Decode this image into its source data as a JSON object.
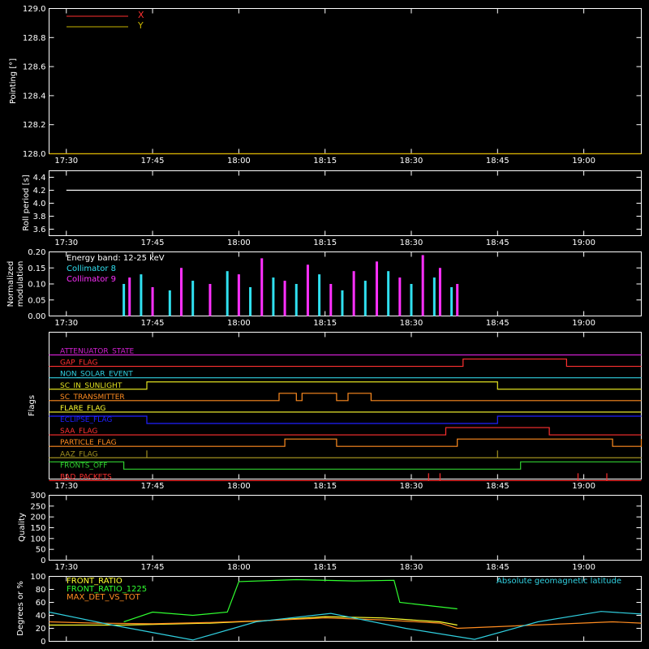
{
  "time_ticks": [
    "17:30",
    "17:45",
    "18:00",
    "18:15",
    "18:30",
    "18:45",
    "19:00"
  ],
  "time_range": [
    "17:27",
    "19:10"
  ],
  "colors": {
    "background": "#000000",
    "axes": "#ffffff",
    "x": "#ff3030",
    "y": "#c8b400",
    "collimator8": "#30e0f0",
    "collimator9": "#ff30ff",
    "front_ratio": "#ffff30",
    "front_ratio_1225": "#30ff30",
    "max_det": "#ff8c20",
    "geomag": "#30d0e0"
  },
  "chart_data": [
    {
      "type": "line",
      "ylabel": "Pointing [°]",
      "ylim": [
        128.0,
        129.0
      ],
      "yticks": [
        "128.0",
        "128.2",
        "128.4",
        "128.6",
        "128.8",
        "129.0"
      ],
      "legend": [
        "X",
        "Y"
      ],
      "series": [
        {
          "name": "X",
          "x": [
            "17:27",
            "19:10"
          ],
          "values": [
            128.0,
            128.0
          ]
        },
        {
          "name": "Y",
          "x": [
            "17:27",
            "19:10"
          ],
          "values": [
            128.0,
            128.0
          ]
        }
      ]
    },
    {
      "type": "line",
      "ylabel": "Roll period [s]",
      "ylim": [
        3.5,
        4.5
      ],
      "yticks": [
        "3.6",
        "3.8",
        "4.0",
        "4.2",
        "4.4"
      ],
      "series": [
        {
          "x": [
            "17:30",
            "17:45",
            "18:00",
            "18:15",
            "18:30",
            "18:45",
            "19:00",
            "19:10"
          ],
          "values": [
            4.2,
            4.2,
            4.2,
            4.2,
            4.2,
            4.2,
            4.2,
            4.2
          ]
        }
      ]
    },
    {
      "type": "bar",
      "ylabel": [
        "Normalized",
        "modulation"
      ],
      "ylim": [
        0,
        0.2
      ],
      "yticks": [
        "0.00",
        "0.05",
        "0.10",
        "0.15",
        "0.20"
      ],
      "annotation": "Energy band: 12-25 keV",
      "series": [
        {
          "name": "Collimator 8",
          "x": [
            "17:40",
            "17:43",
            "17:48",
            "17:52",
            "17:58",
            "18:02",
            "18:06",
            "18:10",
            "18:14",
            "18:18",
            "18:22",
            "18:26",
            "18:30",
            "18:34",
            "18:37"
          ],
          "values": [
            0.1,
            0.13,
            0.08,
            0.11,
            0.14,
            0.09,
            0.12,
            0.1,
            0.13,
            0.08,
            0.11,
            0.14,
            0.1,
            0.12,
            0.09
          ]
        },
        {
          "name": "Collimator 9",
          "x": [
            "17:41",
            "17:45",
            "17:50",
            "17:55",
            "18:00",
            "18:04",
            "18:08",
            "18:12",
            "18:16",
            "18:20",
            "18:24",
            "18:28",
            "18:32",
            "18:35",
            "18:38"
          ],
          "values": [
            0.12,
            0.09,
            0.15,
            0.1,
            0.13,
            0.18,
            0.11,
            0.16,
            0.1,
            0.14,
            0.17,
            0.12,
            0.19,
            0.15,
            0.1
          ]
        }
      ]
    },
    {
      "type": "line",
      "ylabel": "Flags",
      "flags": [
        {
          "name": "ATTENUATOR_STATE",
          "color": "#d020d0",
          "transitions": [
            [
              "17:27",
              0
            ]
          ]
        },
        {
          "name": "GAP_FLAG",
          "color": "#ff3030",
          "transitions": [
            [
              "17:27",
              0
            ],
            [
              "18:39",
              1
            ],
            [
              "18:57",
              0
            ]
          ]
        },
        {
          "name": "NON_SOLAR_EVENT",
          "color": "#30d0e0",
          "transitions": [
            [
              "17:27",
              0
            ]
          ]
        },
        {
          "name": "SC_IN_SUNLIGHT",
          "color": "#e0e020",
          "transitions": [
            [
              "17:27",
              0
            ],
            [
              "17:44",
              1
            ],
            [
              "18:45",
              0
            ]
          ]
        },
        {
          "name": "SC_TRANSMITTER",
          "color": "#ff8c20",
          "transitions": [
            [
              "17:27",
              0
            ],
            [
              "18:07",
              1
            ],
            [
              "18:10",
              0
            ],
            [
              "18:11",
              1
            ],
            [
              "18:17",
              0
            ],
            [
              "18:19",
              1
            ],
            [
              "18:23",
              0
            ]
          ]
        },
        {
          "name": "FLARE_FLAG",
          "color": "#ffff30",
          "transitions": [
            [
              "17:27",
              0
            ]
          ]
        },
        {
          "name": "ECLIPSE_FLAG",
          "color": "#2020ff",
          "transitions": [
            [
              "17:27",
              1
            ],
            [
              "17:44",
              0
            ],
            [
              "18:45",
              1
            ]
          ]
        },
        {
          "name": "SAA_FLAG",
          "color": "#ff3030",
          "transitions": [
            [
              "17:27",
              0
            ],
            [
              "18:36",
              1
            ],
            [
              "18:54",
              0
            ]
          ]
        },
        {
          "name": "PARTICLE_FLAG",
          "color": "#ff8c20",
          "transitions": [
            [
              "17:27",
              0
            ],
            [
              "18:08",
              1
            ],
            [
              "18:17",
              0
            ],
            [
              "18:38",
              1
            ],
            [
              "19:05",
              0
            ],
            [
              "19:10",
              1
            ]
          ]
        },
        {
          "name": "AAZ_FLAG",
          "color": "#a09020",
          "transitions": [
            [
              "17:27",
              0
            ],
            [
              "17:44",
              1
            ],
            [
              "17:44",
              0
            ],
            [
              "18:45",
              1
            ],
            [
              "18:45",
              0
            ]
          ]
        },
        {
          "name": "FRONTS_OFF",
          "color": "#30d030",
          "transitions": [
            [
              "17:27",
              1
            ],
            [
              "17:40",
              0
            ],
            [
              "18:49",
              1
            ]
          ]
        },
        {
          "name": "BAD_PACKETS",
          "color": "#ff3030",
          "transitions": [
            [
              "17:27",
              0
            ],
            [
              "18:33",
              1
            ],
            [
              "18:33",
              0
            ],
            [
              "18:35",
              1
            ],
            [
              "18:35",
              0
            ],
            [
              "18:59",
              1
            ],
            [
              "18:59",
              0
            ],
            [
              "19:04",
              1
            ],
            [
              "19:04",
              0
            ]
          ]
        }
      ]
    },
    {
      "type": "line",
      "ylabel": "Quality",
      "ylim": [
        0,
        300
      ],
      "yticks": [
        "0",
        "50",
        "100",
        "150",
        "200",
        "250",
        "300"
      ],
      "series": []
    },
    {
      "type": "line",
      "ylabel": "Degrees or %",
      "ylim": [
        0,
        100
      ],
      "yticks": [
        "0",
        "20",
        "40",
        "60",
        "80",
        "100"
      ],
      "legend": [
        "FRONT_RATIO",
        "FRONT_RATIO_1225",
        "MAX_DET_VS_TOT"
      ],
      "legend_right": "Absolute geomagnetic latitude",
      "series": [
        {
          "name": "FRONT_RATIO",
          "x": [
            "17:27",
            "17:40",
            "17:55",
            "18:05",
            "18:15",
            "18:25",
            "18:35",
            "18:38"
          ],
          "values": [
            25,
            25,
            28,
            32,
            38,
            36,
            30,
            25
          ]
        },
        {
          "name": "FRONT_RATIO_1225",
          "x": [
            "17:40",
            "17:45",
            "17:52",
            "17:58",
            "18:00",
            "18:10",
            "18:20",
            "18:27",
            "18:28",
            "18:33",
            "18:38"
          ],
          "values": [
            30,
            45,
            40,
            45,
            92,
            95,
            93,
            94,
            60,
            55,
            50
          ]
        },
        {
          "name": "MAX_DET_VS_TOT",
          "x": [
            "17:27",
            "17:35",
            "17:45",
            "17:55",
            "18:05",
            "18:15",
            "18:25",
            "18:35",
            "18:38",
            "19:05",
            "19:10"
          ],
          "values": [
            30,
            28,
            27,
            29,
            32,
            36,
            33,
            28,
            20,
            30,
            28
          ]
        },
        {
          "name": "Absolute geomagnetic latitude",
          "x": [
            "17:27",
            "17:38",
            "17:52",
            "18:03",
            "18:16",
            "18:29",
            "18:41",
            "18:52",
            "19:03",
            "19:10"
          ],
          "values": [
            45,
            25,
            2,
            30,
            43,
            20,
            3,
            30,
            46,
            42
          ]
        }
      ]
    }
  ]
}
